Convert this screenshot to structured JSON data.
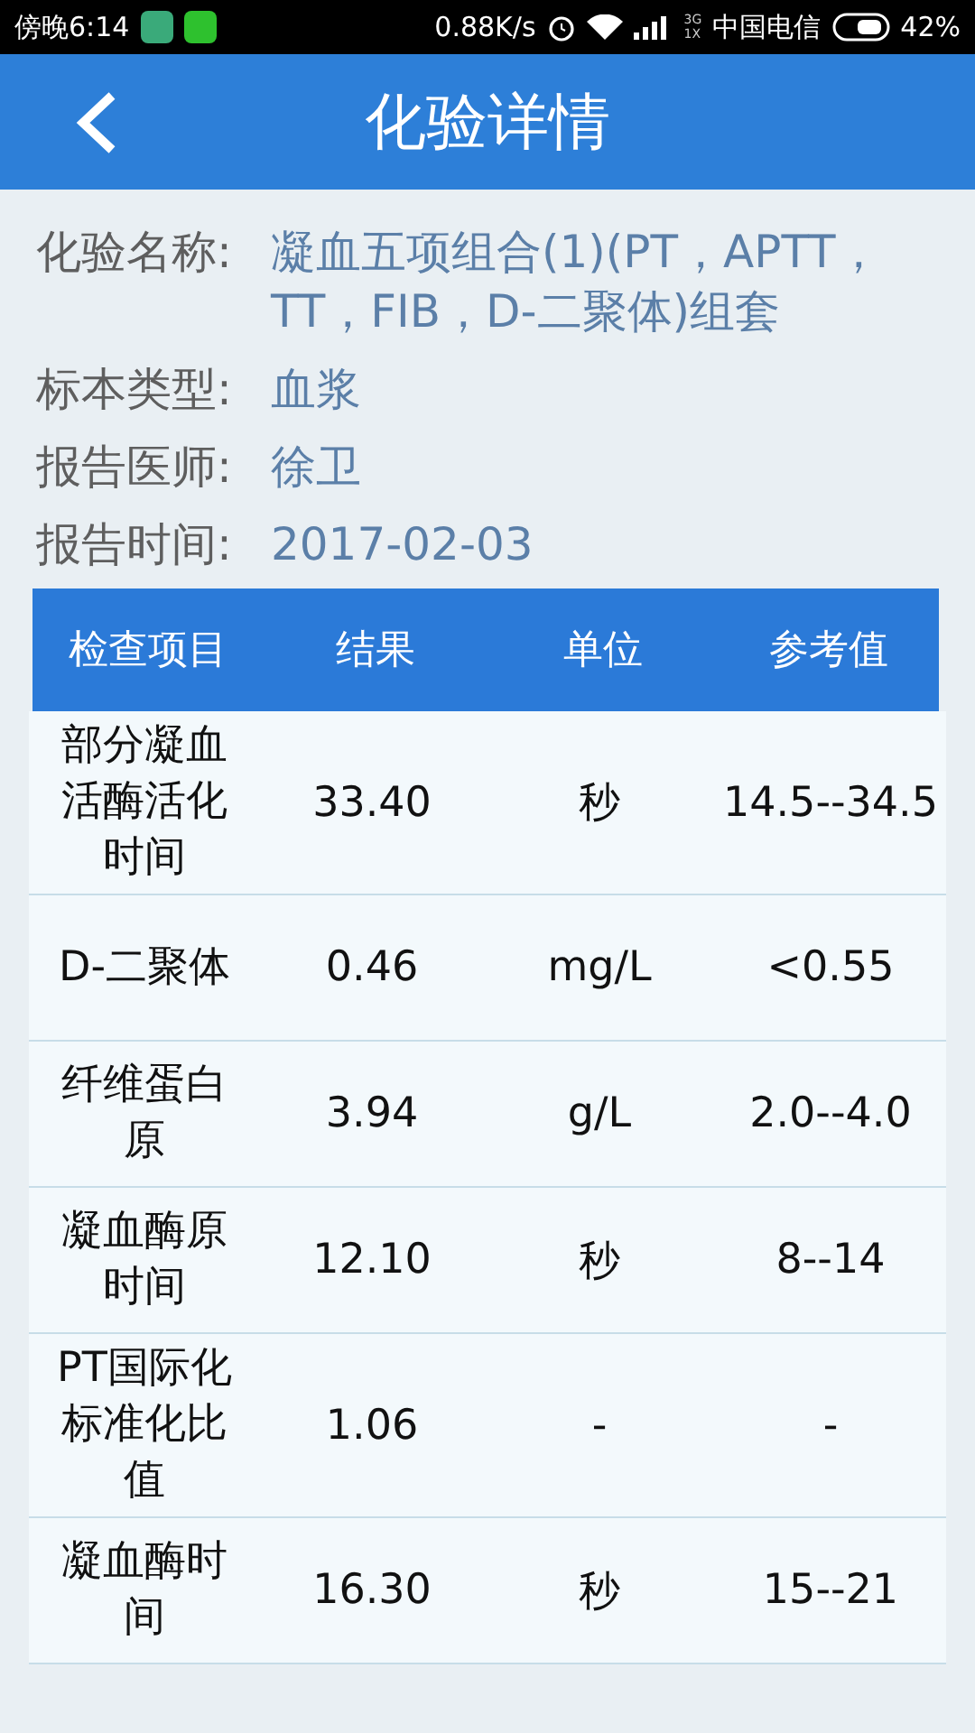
{
  "status_bar": {
    "time": "傍晚6:14",
    "speed": "0.88K/s",
    "network_type": "3G\n1X",
    "carrier": "中国电信",
    "battery": "42%"
  },
  "header": {
    "title": "化验详情"
  },
  "info": [
    {
      "label": "化验名称:",
      "value": "凝血五项组合(1)(PT，APTT，TT，FIB，D-二聚体)组套"
    },
    {
      "label": "标本类型:",
      "value": "血浆"
    },
    {
      "label": "报告医师:",
      "value": "徐卫"
    },
    {
      "label": "报告时间:",
      "value": "2017-02-03"
    }
  ],
  "table": {
    "columns": [
      "检查项目",
      "结果",
      "单位",
      "参考值"
    ],
    "rows": [
      [
        "部分凝血活酶活化时间",
        "33.40",
        "秒",
        "14.5--34.5"
      ],
      [
        "D-二聚体",
        "0.46",
        "mg/L",
        "<0.55"
      ],
      [
        "纤维蛋白原",
        "3.94",
        "g/L",
        "2.0--4.0"
      ],
      [
        "凝血酶原时间",
        "12.10",
        "秒",
        "8--14"
      ],
      [
        "PT国际化标准化比值",
        "1.06",
        "-",
        "-"
      ],
      [
        "凝血酶时间",
        "16.30",
        "秒",
        "15--21"
      ]
    ]
  }
}
